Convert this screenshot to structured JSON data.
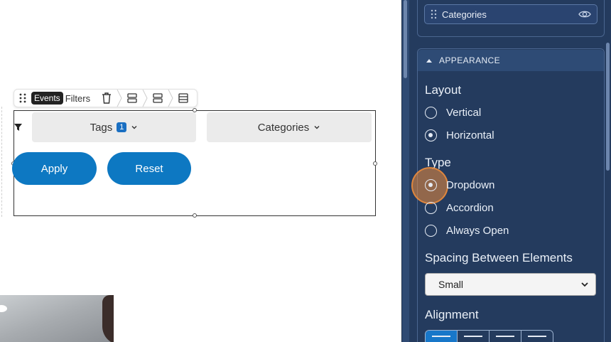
{
  "toolbar": {
    "events_label": "Events",
    "filters_label": "Filters"
  },
  "widget": {
    "tags_label": "Tags",
    "tags_badge": "1",
    "categories_label": "Categories",
    "apply_label": "Apply",
    "reset_label": "Reset"
  },
  "panel": {
    "categories_item": "Categories",
    "appearance_title": "APPEARANCE",
    "layout": {
      "label": "Layout",
      "options": [
        "Vertical",
        "Horizontal"
      ],
      "selected": "Horizontal"
    },
    "type": {
      "label": "Type",
      "options": [
        "Dropdown",
        "Accordion",
        "Always Open"
      ],
      "selected": "Dropdown"
    },
    "spacing": {
      "label": "Spacing Between Elements",
      "value": "Small"
    },
    "alignment": {
      "label": "Alignment",
      "selected_index": 0
    }
  },
  "colors": {
    "accent": "#0d78c2",
    "panel_bg": "#243b5e",
    "highlight": "#ec8c3c"
  }
}
